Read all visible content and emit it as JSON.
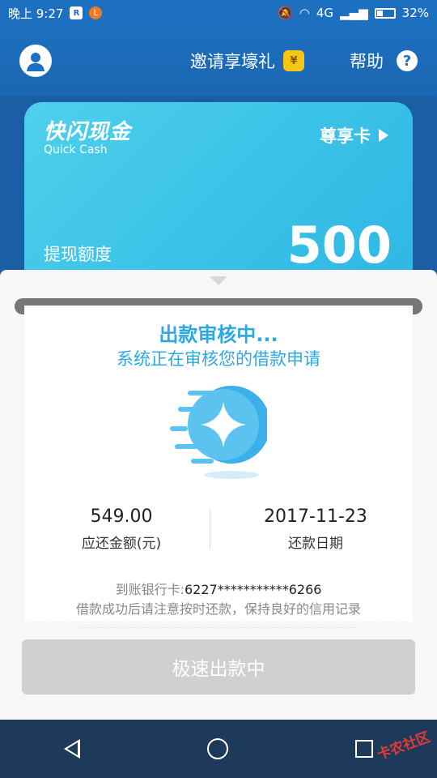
{
  "status_bar": {
    "time": "晚上 9:27",
    "app_badge": "R",
    "notif_badge": "L",
    "network": "4G",
    "battery": "32%"
  },
  "header": {
    "invite": "邀请享壕礼",
    "gift_symbol": "¥",
    "help": "帮助",
    "help_symbol": "?"
  },
  "card": {
    "brand_cn": "快闪现金",
    "brand_en": "Quick Cash",
    "vip_label": "尊享卡",
    "limit_label": "提现额度",
    "limit_value": "500"
  },
  "panel": {
    "title": "出款审核中...",
    "subtitle": "系统正在审核您的借款申请",
    "amount_value": "549.00",
    "amount_label": "应还金额(元)",
    "date_value": "2017-11-23",
    "date_label": "还款日期",
    "bank_label": "到账银行卡:",
    "bank_number": "6227***********6266",
    "tip": "借款成功后请注意按时还款，保持良好的信用记录",
    "cta": "极速出款中"
  },
  "watermark": "卡农社区",
  "colors": {
    "header_blue": "#1d6fbf",
    "card_cyan": "#3cc3e8",
    "accent": "#2ea8e0",
    "disabled": "#d0d0d0"
  }
}
